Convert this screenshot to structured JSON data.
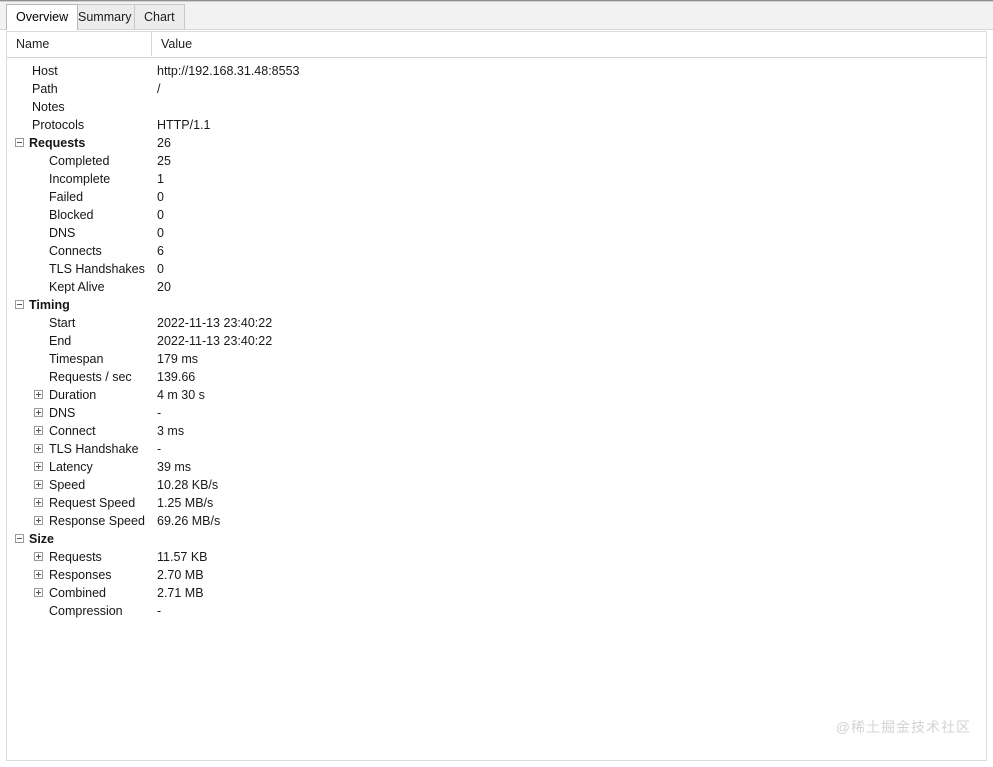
{
  "window": {
    "tabs": [
      {
        "id": "overview",
        "label": "Overview",
        "active": true
      },
      {
        "id": "summary",
        "label": "Summary",
        "active": false
      },
      {
        "id": "chart",
        "label": "Chart",
        "active": false
      }
    ]
  },
  "table": {
    "columns": {
      "name": "Name",
      "value": "Value"
    },
    "rows": [
      {
        "level": "lvl1",
        "expander": "none",
        "name": "Host",
        "value": "http://192.168.31.48:8553"
      },
      {
        "level": "lvl1",
        "expander": "none",
        "name": "Path",
        "value": "/"
      },
      {
        "level": "lvl1",
        "expander": "none",
        "name": "Notes",
        "value": ""
      },
      {
        "level": "lvl1",
        "expander": "none",
        "name": "Protocols",
        "value": "HTTP/1.1"
      },
      {
        "level": "lvl0",
        "expander": "minus",
        "name": "Requests",
        "value": "26"
      },
      {
        "level": "lvl1x",
        "expander": "none",
        "name": "Completed",
        "value": "25"
      },
      {
        "level": "lvl1x",
        "expander": "none",
        "name": "Incomplete",
        "value": "1"
      },
      {
        "level": "lvl1x",
        "expander": "none",
        "name": "Failed",
        "value": "0"
      },
      {
        "level": "lvl1x",
        "expander": "none",
        "name": "Blocked",
        "value": "0"
      },
      {
        "level": "lvl1x",
        "expander": "none",
        "name": "DNS",
        "value": "0"
      },
      {
        "level": "lvl1x",
        "expander": "none",
        "name": "Connects",
        "value": "6"
      },
      {
        "level": "lvl1x",
        "expander": "none",
        "name": "TLS Handshakes",
        "value": "0"
      },
      {
        "level": "lvl1x",
        "expander": "none",
        "name": "Kept Alive",
        "value": "20"
      },
      {
        "level": "lvl0",
        "expander": "minus",
        "name": "Timing",
        "value": ""
      },
      {
        "level": "lvl1x",
        "expander": "none",
        "name": "Start",
        "value": "2022-11-13 23:40:22"
      },
      {
        "level": "lvl1x",
        "expander": "none",
        "name": "End",
        "value": "2022-11-13 23:40:22"
      },
      {
        "level": "lvl1x",
        "expander": "none",
        "name": "Timespan",
        "value": "179 ms"
      },
      {
        "level": "lvl1x",
        "expander": "none",
        "name": "Requests / sec",
        "value": "139.66"
      },
      {
        "level": "lvl1x",
        "expander": "plus",
        "name": "Duration",
        "value": "4 m 30 s"
      },
      {
        "level": "lvl1x",
        "expander": "plus",
        "name": "DNS",
        "value": "-"
      },
      {
        "level": "lvl1x",
        "expander": "plus",
        "name": "Connect",
        "value": "3 ms"
      },
      {
        "level": "lvl1x",
        "expander": "plus",
        "name": "TLS Handshake",
        "value": "-"
      },
      {
        "level": "lvl1x",
        "expander": "plus",
        "name": "Latency",
        "value": "39 ms"
      },
      {
        "level": "lvl1x",
        "expander": "plus",
        "name": "Speed",
        "value": "10.28 KB/s"
      },
      {
        "level": "lvl1x",
        "expander": "plus",
        "name": "Request Speed",
        "value": "1.25 MB/s"
      },
      {
        "level": "lvl1x",
        "expander": "plus",
        "name": "Response Speed",
        "value": "69.26 MB/s"
      },
      {
        "level": "lvl0",
        "expander": "minus",
        "name": "Size",
        "value": ""
      },
      {
        "level": "lvl1x",
        "expander": "plus",
        "name": "Requests",
        "value": "11.57 KB"
      },
      {
        "level": "lvl1x",
        "expander": "plus",
        "name": "Responses",
        "value": "2.70 MB"
      },
      {
        "level": "lvl1x",
        "expander": "plus",
        "name": "Combined",
        "value": "2.71 MB"
      },
      {
        "level": "lvl1x",
        "expander": "none",
        "name": "Compression",
        "value": "-"
      }
    ]
  },
  "watermark": {
    "text": "@稀土掘金技术社区"
  }
}
